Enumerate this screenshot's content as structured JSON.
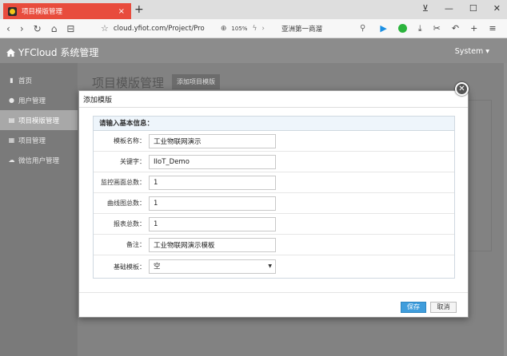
{
  "browser": {
    "tab_title": "项目模版管理",
    "tab_close": "×",
    "new_tab": "+",
    "window_buttons": [
      "⊻",
      "—",
      "☐",
      "✕"
    ],
    "nav_buttons": [
      "‹",
      "›",
      "↻",
      "⌂",
      "⊟"
    ],
    "url": "cloud.yfiot.com/Project/Pro",
    "zoom": "105%",
    "search_text": "亚洲第一商溜"
  },
  "header": {
    "brand": "YFCloud 系统管理",
    "user": "System ▾"
  },
  "sidebar": {
    "items": [
      {
        "icon": "▮",
        "label": "首页"
      },
      {
        "icon": "●",
        "label": "用户管理"
      },
      {
        "icon": "▤",
        "label": "项目模版管理"
      },
      {
        "icon": "▦",
        "label": "项目管理"
      },
      {
        "icon": "☁",
        "label": "微信用户管理"
      }
    ]
  },
  "main": {
    "page_title": "项目模版管理",
    "add_button": "添加项目模版"
  },
  "modal": {
    "title": "添加模版",
    "close": "✕",
    "section_header": "请输入基本信息：",
    "fields": [
      {
        "label": "模板名称：",
        "value": "工业物联网演示"
      },
      {
        "label": "关键字：",
        "value": "IIoT_Demo"
      },
      {
        "label": "监控画面总数：",
        "value": "1"
      },
      {
        "label": "曲线图总数：",
        "value": "1"
      },
      {
        "label": "报表总数：",
        "value": "1"
      },
      {
        "label": "备注：",
        "value": "工业物联网演示模板"
      }
    ],
    "base_template": {
      "label": "基础模板：",
      "value": "空"
    },
    "save_button": "保存",
    "cancel_button": "取消"
  },
  "colors": {
    "tab_active": "#e84c3d",
    "save_button": "#3f9ddc",
    "form_header_bg": "#eef5fb"
  }
}
